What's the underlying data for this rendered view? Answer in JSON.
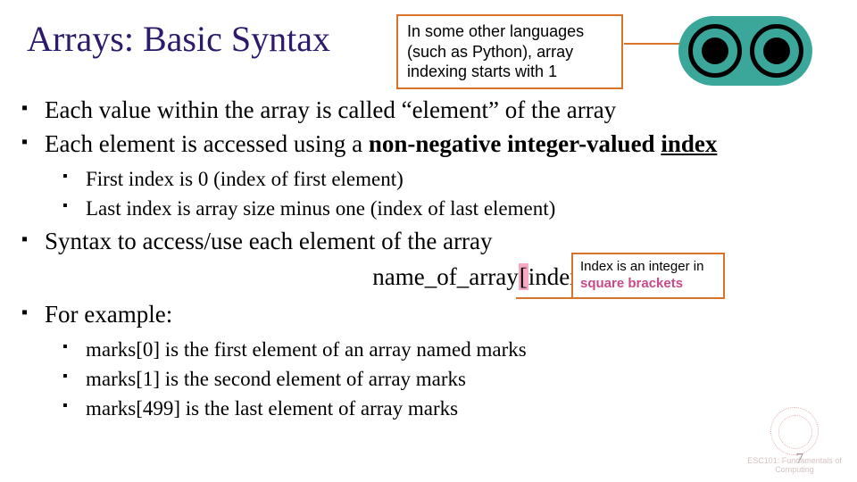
{
  "title": "Arrays: Basic Syntax",
  "callout1": "In some other languages (such as Python), array indexing starts with 1",
  "bullets": {
    "b1_a": "Each value within the array is called “element” of the array",
    "b2_a": "Each element is accessed using a ",
    "b2_b": "non-negative integer-valued ",
    "b2_c": "index",
    "sub1a": "First index is 0 (index of first element)",
    "sub1b": "Last index is array size minus one (index of last element)",
    "b3": "Syntax to access/use each element of the array",
    "syntax_a": "name_of_array",
    "syntax_lb": "[",
    "syntax_m": "index",
    "syntax_rb": "]",
    "b4": "For example:",
    "sub2a": "marks[0] is the first element of an array named marks",
    "sub2b": "marks[1] is the second element of array marks",
    "sub2c": "marks[499] is the last element of array marks"
  },
  "callout2_a": "Index is an integer in ",
  "callout2_b": "square brackets",
  "pagenum": "7",
  "watermark": "ESC101: Fundamentals of Computing"
}
